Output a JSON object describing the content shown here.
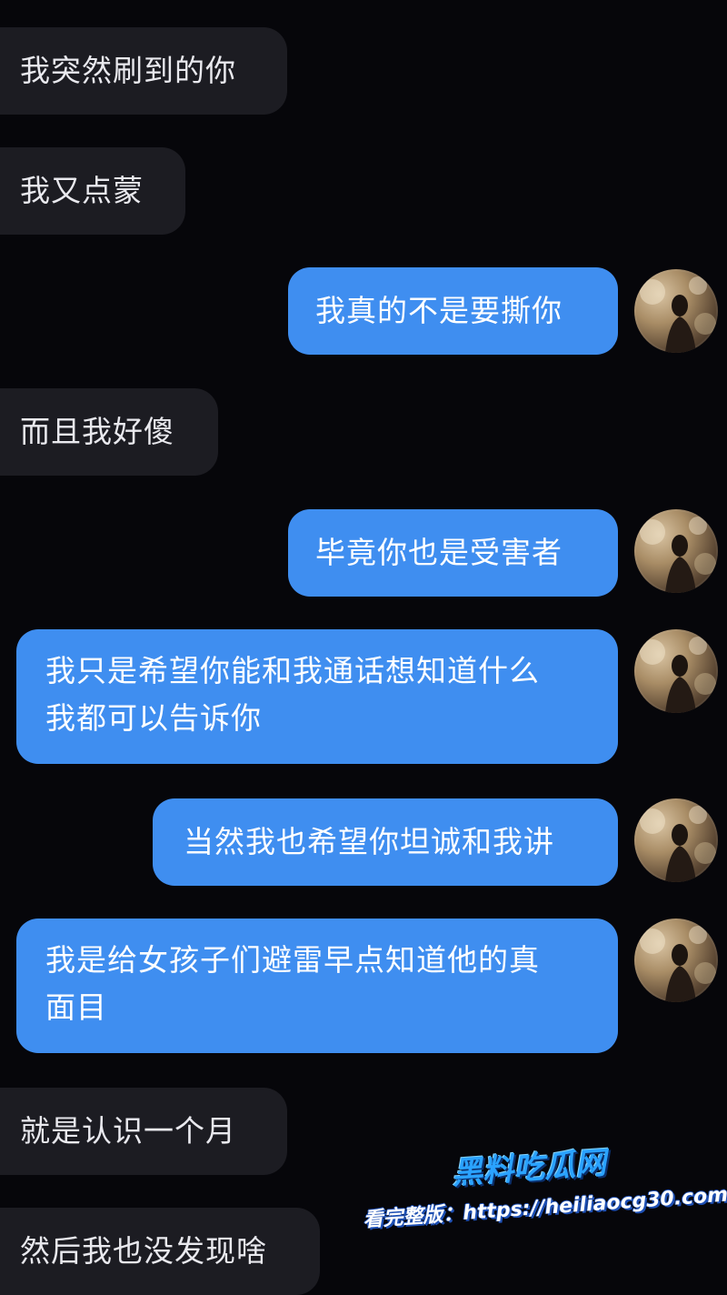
{
  "messages": [
    {
      "side": "in",
      "text": "我突然刷到的你"
    },
    {
      "side": "in",
      "text": "我又点蒙"
    },
    {
      "side": "out",
      "text": "我真的不是要撕你"
    },
    {
      "side": "in",
      "text": "而且我好傻"
    },
    {
      "side": "out",
      "text": "毕竟你也是受害者"
    },
    {
      "side": "out",
      "line1": "我只是希望你能和我通话想知道什么",
      "line2": "我都可以告诉你"
    },
    {
      "side": "out",
      "text": "当然我也希望你坦诚和我讲"
    },
    {
      "side": "out",
      "line1": "我是给女孩子们避雷早点知道他的真",
      "line2": "面目"
    },
    {
      "side": "in",
      "text": "就是认识一个月"
    },
    {
      "side": "in",
      "text": "然后我也没发现啥"
    }
  ],
  "watermark": {
    "brand": "黑料吃瓜网",
    "url": "看完整版：https://heiliaocg30.com"
  },
  "colors": {
    "background": "#06060a",
    "incoming_bubble": "#1c1c22",
    "outgoing_bubble": "#3f8ef0"
  },
  "icons": {
    "avatar": "user-avatar-photo"
  }
}
